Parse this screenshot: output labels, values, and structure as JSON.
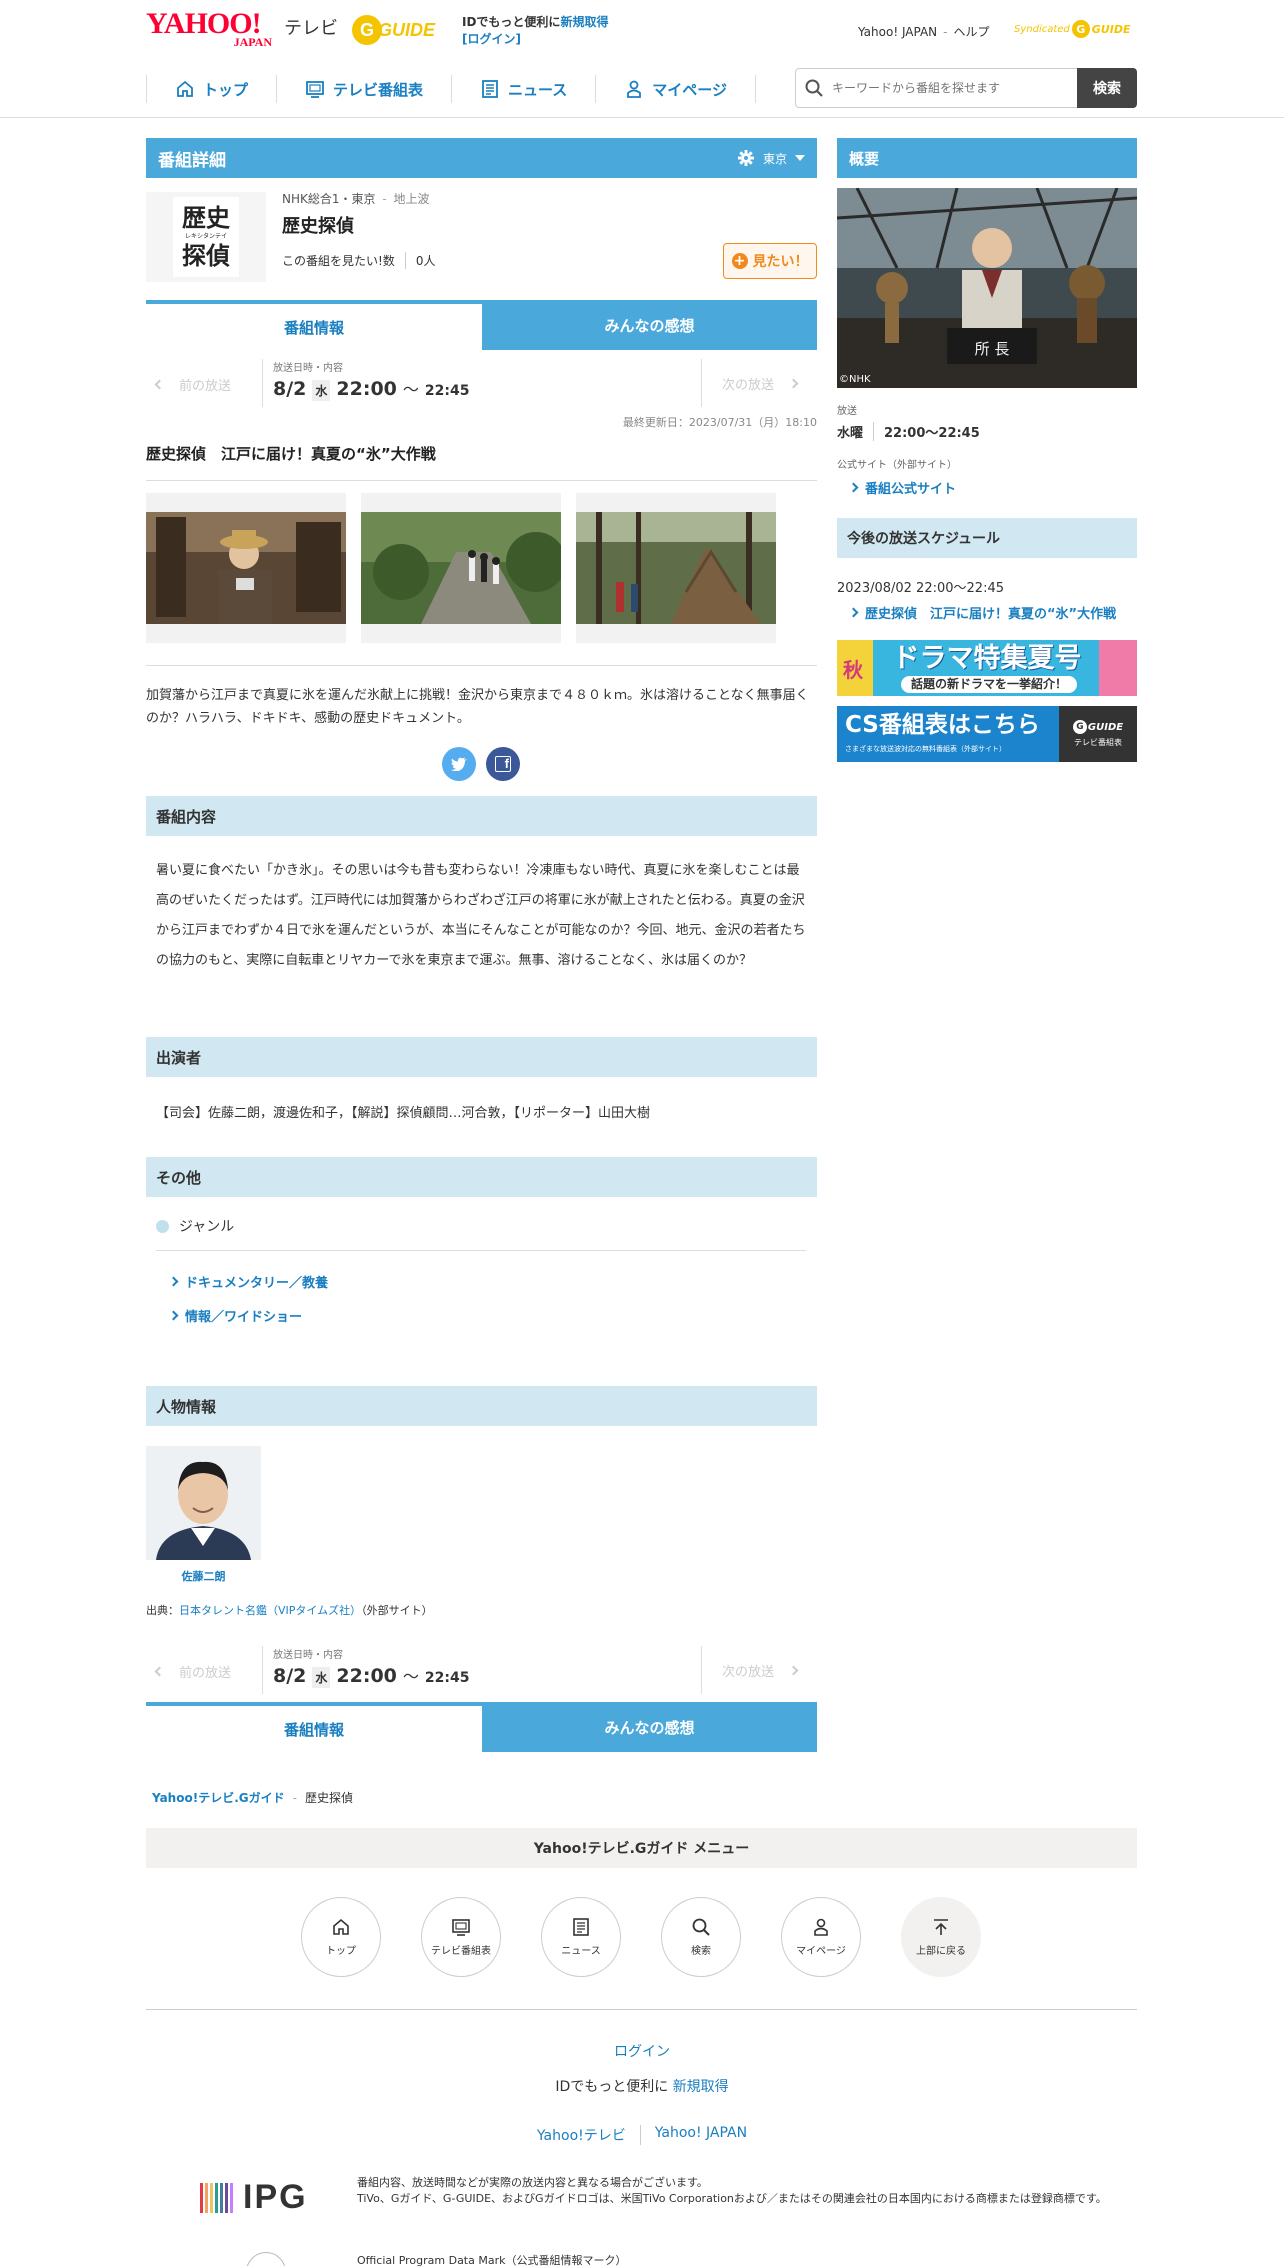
{
  "header": {
    "logo_yahoo": "YAHOO!",
    "logo_japan": "JAPAN",
    "logo_tv": "テレビ",
    "logo_gguide": "G GUIDE",
    "promo_text": "IDでもっと便利に",
    "promo_signup": "新規取得",
    "promo_login": "[ログイン]",
    "link_yahoo": "Yahoo! JAPAN",
    "link_help": "ヘルプ",
    "syndicated": "Syndicated",
    "gguide_small": "GUIDE"
  },
  "nav": {
    "items": [
      {
        "label": "トップ",
        "icon": "home-icon"
      },
      {
        "label": "テレビ番組表",
        "icon": "tv-icon"
      },
      {
        "label": "ニュース",
        "icon": "news-icon"
      },
      {
        "label": "マイページ",
        "icon": "person-icon"
      }
    ],
    "search_placeholder": "キーワードから番組を探せます",
    "search_button": "検索"
  },
  "detail": {
    "title": "番組詳細",
    "region": "東京",
    "channel": "NHK総合1・東京",
    "broadcast_type": "地上波",
    "program_name": "歴史探偵",
    "want_count_label": "この番組を見たい!数",
    "want_count": "0人",
    "want_button": "見たい！",
    "logo_line1": "歴史",
    "logo_line2": "探偵",
    "logo_ruby": "レキシタンテイ"
  },
  "tabs": {
    "info": "番組情報",
    "reviews": "みんなの感想"
  },
  "broadcast_nav": {
    "prev": "前の放送",
    "next": "次の放送",
    "label": "放送日時・内容",
    "date": "8/2",
    "weekday": "水",
    "start": "22:00",
    "tilde": "〜",
    "end": "22:45"
  },
  "updated": "最終更新日：2023/07/31（月）18:10",
  "episode_title": "歴史探偵　江戸に届け！真夏の“氷”大作戦",
  "summary": "加賀藩から江戸まで真夏に氷を運んだ氷献上に挑戦！金沢から東京まで４８０ｋｍ。氷は溶けることなく無事届くのか？ハラハラ、ドキドキ、感動の歴史ドキュメント。",
  "social": {
    "twitter": "t",
    "facebook": "f"
  },
  "sections": {
    "content_title": "番組内容",
    "content_text": "暑い夏に食べたい「かき氷」。その思いは今も昔も変わらない！冷凍庫もない時代、真夏に氷を楽しむことは最高のぜいたくだったはず。江戸時代には加賀藩からわざわざ江戸の将軍に氷が献上されたと伝わる。真夏の金沢から江戸までわずか４日で氷を運んだというが、本当にそんなことが可能なのか？今回、地元、金沢の若者たちの協力のもと、実際に自転車とリヤカーで氷を東京まで運ぶ。無事、溶けることなく、氷は届くのか？",
    "cast_title": "出演者",
    "cast_text": "【司会】佐藤二朗，渡邊佐和子，【解説】探偵顧問…河合敦，【リポーター】山田大樹",
    "other_title": "その他",
    "genre_label": "ジャンル",
    "genres": [
      "ドキュメンタリー／教養",
      "情報／ワイドショー"
    ],
    "people_title": "人物情報",
    "person_name": "佐藤二朗",
    "source_prefix": "出典：",
    "source_link": "日本タレント名鑑（VIPタイムズ社）",
    "source_suffix": "（外部サイト）"
  },
  "breadcrumb": {
    "home": "Yahoo!テレビ.Gガイド",
    "current": "歴史探偵"
  },
  "footer_menu": {
    "title": "Yahoo!テレビ.Gガイド メニュー",
    "items": [
      {
        "label": "トップ",
        "icon": "home-icon"
      },
      {
        "label": "テレビ番組表",
        "icon": "tv-icon"
      },
      {
        "label": "ニュース",
        "icon": "news-icon"
      },
      {
        "label": "検索",
        "icon": "search-icon"
      },
      {
        "label": "マイページ",
        "icon": "person-icon"
      },
      {
        "label": "上部に戻る",
        "icon": "arrow-up-icon"
      }
    ]
  },
  "footer": {
    "login": "ログイン",
    "promo": "IDでもっと便利に",
    "signup": "新規取得",
    "link1": "Yahoo!テレビ",
    "link2": "Yahoo! JAPAN",
    "ipg_logo": "IPG",
    "notice1": "番組内容、放送時間などが実際の放送内容と異なる場合がございます。",
    "notice2": "TiVo、Gガイド、G-GUIDE、およびGガイドロゴは、米国TiVo Corporationおよび／またはその関連会社の日本国内における商標または登録商標です。",
    "mark": "Official Program Data Mark（公式番組情報マーク）"
  },
  "sidebar": {
    "overview_title": "概要",
    "credit": "©NHK",
    "nameplate": "所 長",
    "broadcast_label": "放送",
    "broadcast_day": "水曜",
    "broadcast_time": "22:00〜22:45",
    "official_label": "公式サイト（外部サイト）",
    "official_link": "番組公式サイト",
    "schedule_title": "今後の放送スケジュール",
    "schedule_datetime": "2023/08/02 22:00〜22:45",
    "schedule_link": "歴史探偵　江戸に届け！真夏の“氷”大作戦",
    "banner1_main": "ドラマ特集夏号",
    "banner1_sub": "話題の新ドラマを一挙紹介！",
    "banner1_tag": "秋",
    "banner2_main": "CS番組表はこちら",
    "banner2_sub": "さまざまな放送波対応の無料番組表（外部サイト）",
    "banner2_logo": "GUIDE",
    "banner2_logo_sub": "テレビ番組表"
  },
  "colors": {
    "accent": "#4aa8db",
    "link": "#1a7fc1",
    "section_bg": "#d1e8f2",
    "orange": "#f08a1d",
    "brand_red": "#ff0033"
  }
}
